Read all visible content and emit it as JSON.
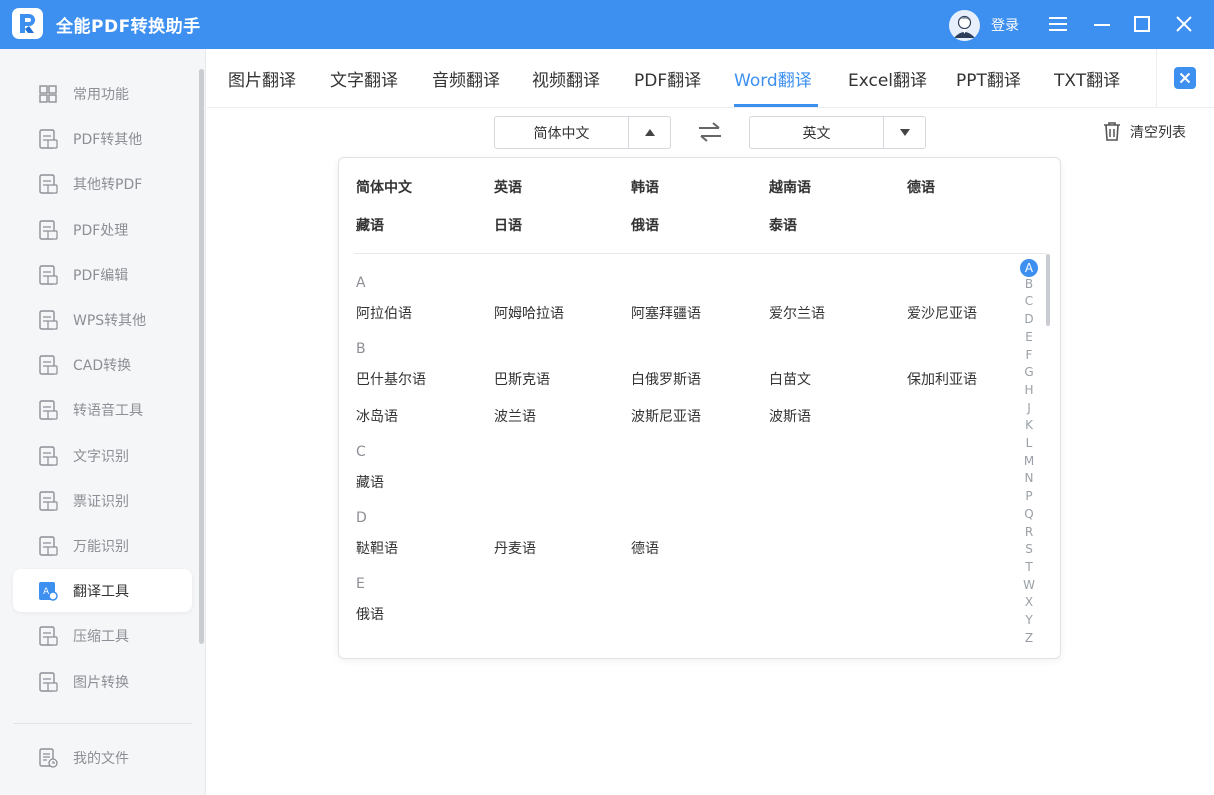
{
  "app": {
    "title": "全能PDF转换助手",
    "login_label": "登录",
    "accent_color": "#3d8ff0"
  },
  "sidebar": {
    "items": [
      {
        "label": "常用功能",
        "icon": "home-grid-icon"
      },
      {
        "label": "PDF转其他",
        "icon": "pdf-export-icon"
      },
      {
        "label": "其他转PDF",
        "icon": "pdf-import-icon"
      },
      {
        "label": "PDF处理",
        "icon": "pdf-process-icon"
      },
      {
        "label": "PDF编辑",
        "icon": "pdf-edit-icon"
      },
      {
        "label": "WPS转其他",
        "icon": "wps-icon"
      },
      {
        "label": "CAD转换",
        "icon": "cad-icon"
      },
      {
        "label": "转语音工具",
        "icon": "text-to-speech-icon"
      },
      {
        "label": "文字识别",
        "icon": "ocr-text-icon"
      },
      {
        "label": "票证识别",
        "icon": "ticket-scan-icon"
      },
      {
        "label": "万能识别",
        "icon": "universal-scan-icon"
      },
      {
        "label": "翻译工具",
        "icon": "translate-icon"
      },
      {
        "label": "压缩工具",
        "icon": "zip-icon"
      },
      {
        "label": "图片转换",
        "icon": "image-convert-icon"
      }
    ],
    "active_index": 11,
    "footer_label": "我的文件"
  },
  "tabs": {
    "items": [
      "图片翻译",
      "文字翻译",
      "音频翻译",
      "视频翻译",
      "PDF翻译",
      "Word翻译",
      "Excel翻译",
      "PPT翻译",
      "TXT翻译"
    ],
    "active_index": 5
  },
  "translator": {
    "source_language": "简体中文",
    "target_language": "英文",
    "clear_list_label": "清空列表"
  },
  "dropdown": {
    "hot_languages": [
      "简体中文",
      "英语",
      "韩语",
      "越南语",
      "德语",
      "藏语",
      "日语",
      "俄语",
      "泰语"
    ],
    "groups": [
      {
        "letter": "A",
        "languages": [
          "阿拉伯语",
          "阿姆哈拉语",
          "阿塞拜疆语",
          "爱尔兰语",
          "爱沙尼亚语"
        ]
      },
      {
        "letter": "B",
        "languages": [
          "巴什基尔语",
          "巴斯克语",
          "白俄罗斯语",
          "白苗文",
          "保加利亚语",
          "冰岛语",
          "波兰语",
          "波斯尼亚语",
          "波斯语"
        ]
      },
      {
        "letter": "C",
        "languages": [
          "藏语"
        ]
      },
      {
        "letter": "D",
        "languages": [
          "鞑靼语",
          "丹麦语",
          "德语"
        ]
      },
      {
        "letter": "E",
        "languages": [
          "俄语"
        ]
      }
    ],
    "alphabet": [
      "A",
      "B",
      "C",
      "D",
      "E",
      "F",
      "G",
      "H",
      "J",
      "K",
      "L",
      "M",
      "N",
      "P",
      "Q",
      "R",
      "S",
      "T",
      "W",
      "X",
      "Y",
      "Z"
    ],
    "active_letter": "A"
  }
}
